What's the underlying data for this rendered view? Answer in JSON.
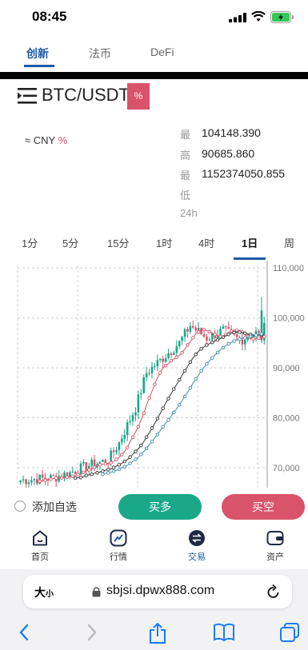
{
  "status": {
    "time": "08:45"
  },
  "top_tabs": [
    {
      "label": "创新",
      "active": true
    },
    {
      "label": "法币",
      "active": false
    },
    {
      "label": "DeFi",
      "active": false
    }
  ],
  "header": {
    "pair": "BTC/USDT",
    "change_badge": "%"
  },
  "cny": {
    "prefix": "≈ CNY",
    "pct": "%"
  },
  "stats": [
    {
      "label": "最",
      "value": "104148.390"
    },
    {
      "label": "高",
      "value": "90685.860"
    },
    {
      "label": "最",
      "value": "1152374050.855"
    },
    {
      "label": "低",
      "value": ""
    },
    {
      "label": "24h",
      "value": ""
    }
  ],
  "time_tabs": [
    {
      "label": "1分",
      "active": false
    },
    {
      "label": "5分",
      "active": false
    },
    {
      "label": "15分",
      "active": false
    },
    {
      "label": "1时",
      "active": false
    },
    {
      "label": "4时",
      "active": false
    },
    {
      "label": "1日",
      "active": true
    },
    {
      "label": "周",
      "active": false
    }
  ],
  "chart_data": {
    "type": "candlestick",
    "ylim": [
      66000,
      110500
    ],
    "y_ticks": [
      "110,000",
      "100,000",
      "90,000",
      "80,000",
      "70,000"
    ],
    "y_tick_values": [
      110000,
      100000,
      90000,
      80000,
      70000
    ],
    "series": [
      {
        "name": "",
        "kind": "ma",
        "color": "#d9536a"
      },
      {
        "name": "",
        "kind": "ma",
        "color": "#333333"
      },
      {
        "name": "",
        "kind": "ma",
        "color": "#3f90a8"
      }
    ],
    "colors": {
      "up": "#1aa889",
      "down": "#d9536a",
      "grid": "#d0d0d0"
    }
  },
  "actions": {
    "favorite": "添加自选",
    "buy": "买多",
    "sell": "买空"
  },
  "bottom_nav": [
    {
      "label": "首页",
      "icon": "home-icon"
    },
    {
      "label": "行情",
      "icon": "market-icon"
    },
    {
      "label": "交易",
      "icon": "trade-icon"
    },
    {
      "label": "资产",
      "icon": "wallet-icon"
    }
  ],
  "browser": {
    "text_size_big": "大",
    "text_size_small": "小",
    "url": "sbjsi.dpwx888.com"
  }
}
